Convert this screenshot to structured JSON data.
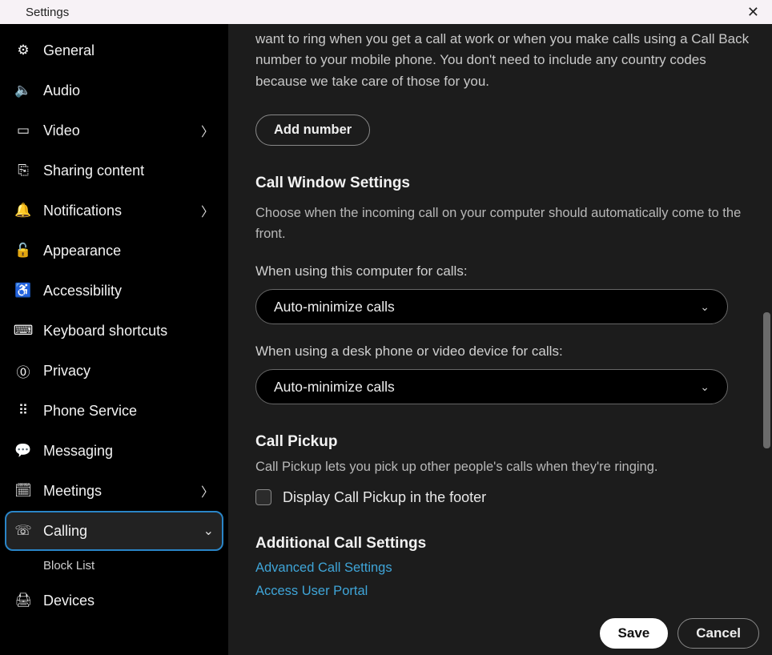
{
  "title": "Settings",
  "sidebar": {
    "items": [
      {
        "icon": "⚙",
        "label": "General"
      },
      {
        "icon": "🔈",
        "label": "Audio"
      },
      {
        "icon": "▭",
        "label": "Video",
        "expandable": true
      },
      {
        "icon": "⎘",
        "label": "Sharing content"
      },
      {
        "icon": "🔔",
        "label": "Notifications",
        "expandable": true
      },
      {
        "icon": "🔓",
        "label": "Appearance"
      },
      {
        "icon": "♿",
        "label": "Accessibility"
      },
      {
        "icon": "⌨",
        "label": "Keyboard shortcuts"
      },
      {
        "icon": "⓪",
        "label": "Privacy"
      },
      {
        "icon": "⠿",
        "label": "Phone Service"
      },
      {
        "icon": "💬",
        "label": "Messaging"
      },
      {
        "icon": "🗓",
        "label": "Meetings",
        "expandable": true
      },
      {
        "icon": "☏",
        "label": "Calling",
        "expandable": true,
        "active": true,
        "open": true,
        "children": [
          {
            "label": "Block List"
          }
        ]
      },
      {
        "icon": "🖨",
        "label": "Devices"
      }
    ]
  },
  "content": {
    "intro_partial": "want to ring when you get a call at work or when you make calls using a Call Back number to your mobile phone. You don't need to include any country codes because we take care of those for you.",
    "add_number": "Add number",
    "call_window": {
      "heading": "Call Window Settings",
      "desc": "Choose when the incoming call on your computer should automatically come to the front.",
      "field1_label": "When using this computer for calls:",
      "field1_value": "Auto-minimize calls",
      "field2_label": "When using a desk phone or video device for calls:",
      "field2_value": "Auto-minimize calls"
    },
    "call_pickup": {
      "heading": "Call Pickup",
      "desc": "Call Pickup lets you pick up other people's calls when they're ringing.",
      "checkbox_label": "Display Call Pickup in the footer",
      "checked": false
    },
    "additional": {
      "heading": "Additional Call Settings",
      "links": [
        "Advanced Call Settings",
        "Access User Portal"
      ]
    }
  },
  "footer": {
    "save": "Save",
    "cancel": "Cancel"
  }
}
